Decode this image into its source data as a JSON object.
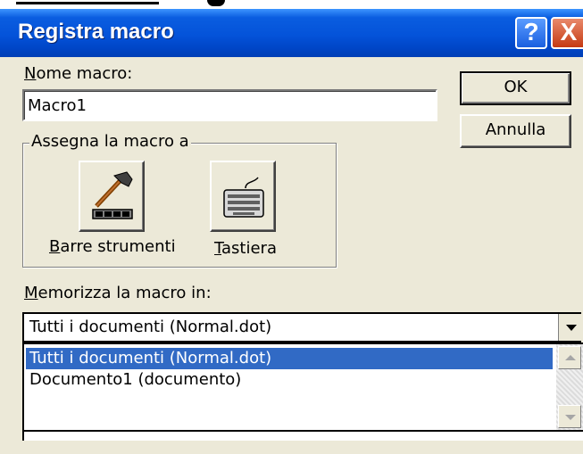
{
  "window": {
    "title": "Registra macro"
  },
  "titlebar_buttons": {
    "help": "?",
    "close": "X"
  },
  "macro_name": {
    "label": "Nome macro:",
    "mnemonic": "N",
    "value": "Macro1"
  },
  "buttons": {
    "ok": "OK",
    "cancel": "Annulla"
  },
  "assign_group": {
    "legend": "Assegna la macro a",
    "toolbars": {
      "mnemonic": "B",
      "rest": "arre strumenti",
      "icon": "hammer-toolbar-icon"
    },
    "keyboard": {
      "mnemonic": "T",
      "rest": "astiera",
      "icon": "keyboard-icon"
    }
  },
  "store_in": {
    "label_mnemonic": "M",
    "label_rest": "emorizza la macro in:",
    "selected": "Tutti i documenti (Normal.dot)",
    "options": [
      "Tutti i documenti (Normal.dot)",
      "Documento1 (documento)"
    ]
  },
  "colors": {
    "titlebar": "#0453d9",
    "selection": "#316ac5",
    "dialog_bg": "#ece9d8"
  }
}
